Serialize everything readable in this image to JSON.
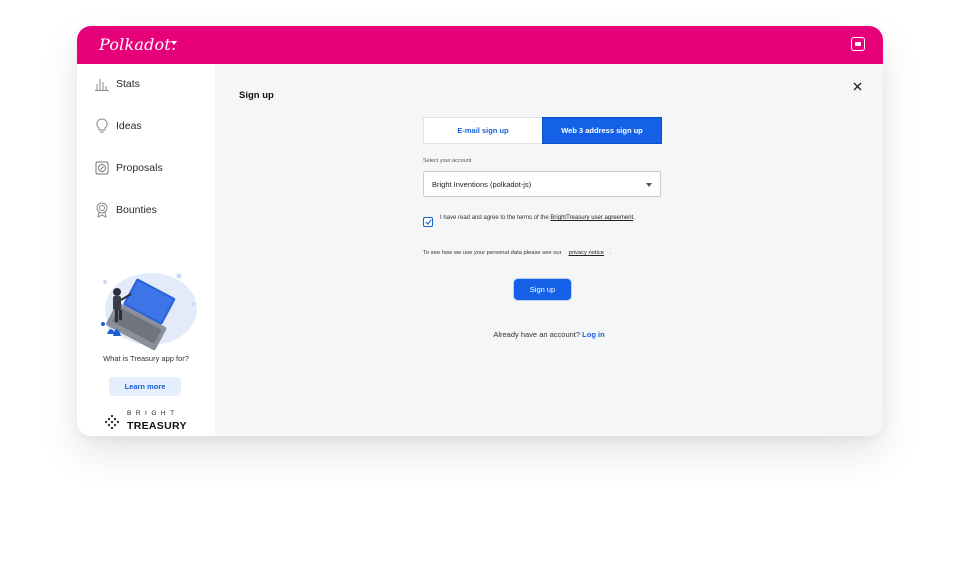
{
  "header": {
    "logo_text": "Polkadot.",
    "brand_color": "#e6007a",
    "account_icon": "wallet-icon"
  },
  "sidebar": {
    "items": [
      {
        "label": "Stats",
        "icon": "bar-chart-icon"
      },
      {
        "label": "Ideas",
        "icon": "lightbulb-icon"
      },
      {
        "label": "Proposals",
        "icon": "compass-icon"
      },
      {
        "label": "Bounties",
        "icon": "medal-icon"
      }
    ],
    "promo_question": "What is Treasury app for?",
    "learn_more_label": "Learn more",
    "brand_top": "BRIGHT",
    "brand_bottom": "TREASURY"
  },
  "main": {
    "title": "Sign up",
    "tabs": [
      {
        "label": "E-mail sign up",
        "active": false
      },
      {
        "label": "Web 3 address sign up",
        "active": true
      }
    ],
    "account_label": "Select your account",
    "account_value": "Bright Inventions (polkadot-js)",
    "agree_prefix": "I have read and agree to the terms of the",
    "agree_link": "BrightTreasury user agreement",
    "agree_suffix": ".",
    "agree_checked": true,
    "privacy_prefix": "To see how we use your personal data please see our",
    "privacy_link": "privacy notice",
    "privacy_suffix": ".",
    "signup_label": "Sign up",
    "login_prefix": "Already have an account?",
    "login_link": "Log in",
    "accent_color": "#1461e8"
  }
}
